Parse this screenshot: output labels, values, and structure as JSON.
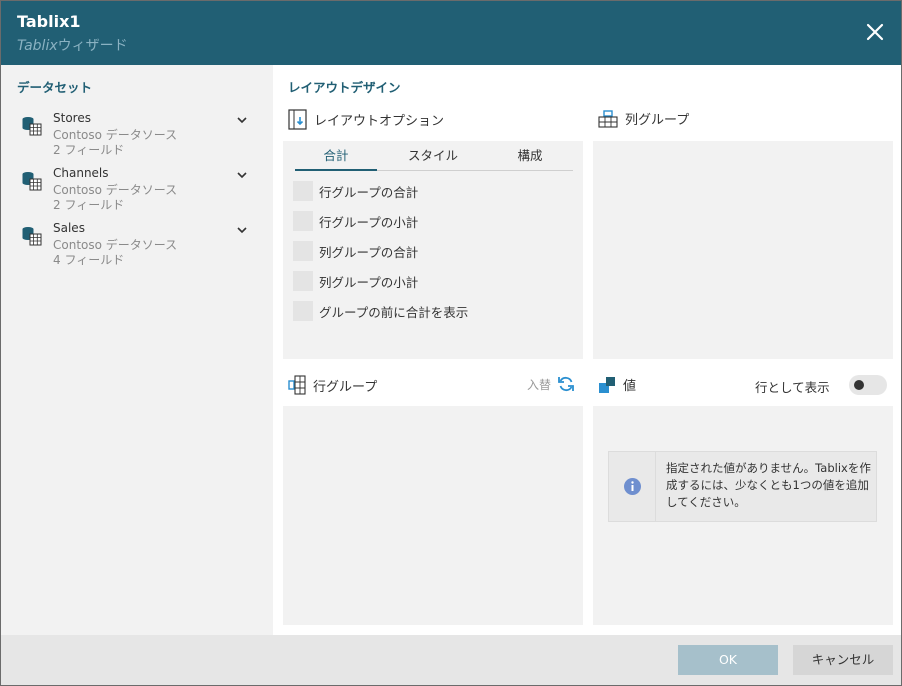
{
  "header": {
    "title": "Tablix1",
    "subtitle_italic": "Tablix",
    "subtitle_rest": "ウィザード"
  },
  "sidebar": {
    "title": "データセット",
    "datasets": [
      {
        "name": "Stores",
        "source": "Contoso データソース",
        "fields": "2 フィールド"
      },
      {
        "name": "Channels",
        "source": "Contoso データソース",
        "fields": "2 フィールド"
      },
      {
        "name": "Sales",
        "source": "Contoso データソース",
        "fields": "4 フィールド"
      }
    ]
  },
  "main": {
    "title": "レイアウトデザイン",
    "layout_options": {
      "title": "レイアウトオプション",
      "tabs": [
        "合計",
        "スタイル",
        "構成"
      ],
      "active_tab": "合計",
      "options": [
        "行グループの合計",
        "行グループの小計",
        "列グループの合計",
        "列グループの小計",
        "グループの前に合計を表示"
      ]
    },
    "column_groups": {
      "title": "列グループ"
    },
    "row_groups": {
      "title": "行グループ",
      "swap_label": "入替"
    },
    "values": {
      "title": "値",
      "toggle_label": "行として表示",
      "info_text": "指定された値がありません。Tablixを作成するには、少なくとも1つの値を追加してください。"
    }
  },
  "footer": {
    "ok": "OK",
    "cancel": "キャンセル"
  },
  "colors": {
    "header": "#215f74",
    "accent": "#215f74",
    "icon_blue": "#2a8fd0",
    "ok_disabled": "#a6c0cb"
  }
}
